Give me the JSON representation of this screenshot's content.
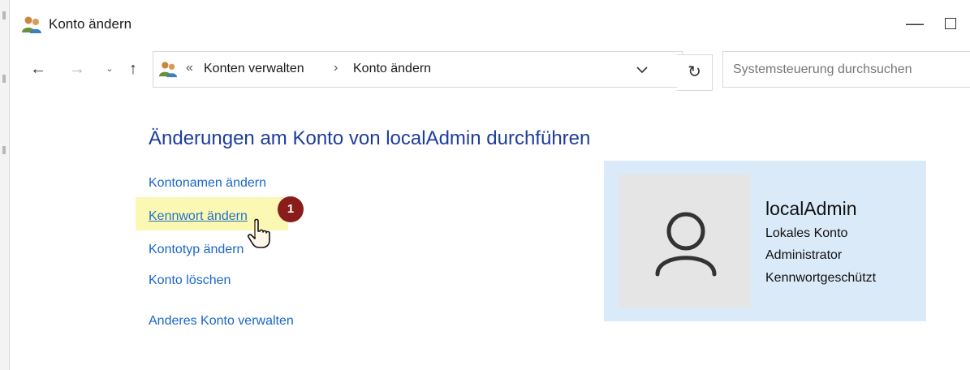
{
  "window": {
    "title": "Konto ändern",
    "minimize_glyph": "—"
  },
  "navigation": {
    "back_glyph": "←",
    "forward_glyph": "→",
    "recent_glyph": "⌄",
    "up_glyph": "↑",
    "breadcrumb_overflow": "«",
    "breadcrumbs": [
      "Konten verwalten",
      "Konto ändern"
    ],
    "breadcrumb_separator": "›",
    "refresh_glyph": "↻",
    "search_placeholder": "Systemsteuerung durchsuchen"
  },
  "main": {
    "title": "Änderungen am Konto von localAdmin durchführen",
    "links": [
      "Kontonamen ändern",
      "Kennwort ändern",
      "Kontotyp ändern",
      "Konto löschen",
      "Anderes Konto verwalten"
    ],
    "step_badge": "1"
  },
  "account": {
    "name": "localAdmin",
    "details": [
      "Lokales Konto",
      "Administrator",
      "Kennwortgeschützt"
    ]
  },
  "colors": {
    "title_blue": "#1e3d9b",
    "link_blue": "#1a66c9",
    "card_bg": "#dbeaf8",
    "highlight": "#fbf8b4",
    "badge": "#8a1c1c"
  },
  "icons": {
    "app": "users-icon",
    "address": "users-icon",
    "avatar": "user-silhouette-icon",
    "cursor": "hand-pointer-icon"
  }
}
